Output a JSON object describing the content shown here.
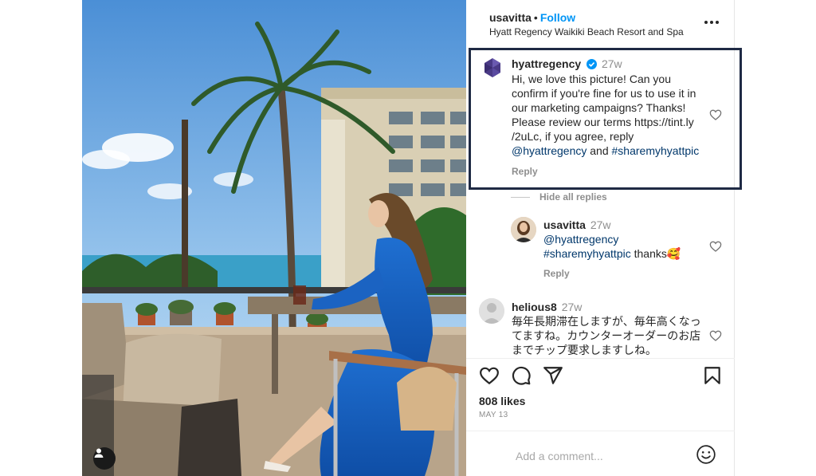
{
  "post": {
    "author": "usavitta",
    "separator": "•",
    "follow_label": "Follow",
    "location": "Hyatt Regency Waikiki Beach Resort and Spa"
  },
  "comments": [
    {
      "user": "hyattregency",
      "verified": true,
      "time": "27w",
      "lines": [
        "Hi, we love this picture! Can you",
        "confirm if you're fine for us to use it in",
        "our marketing campaigns? Thanks!",
        "Please review our terms https://tint.ly",
        "/2uLc, if you agree, reply"
      ],
      "mention": "@hyattregency",
      "conjunction": " and ",
      "hashtag": "#sharemyhyattpic",
      "reply_label": "Reply"
    },
    {
      "user": "usavitta",
      "time": "27w",
      "mention": "@hyattregency",
      "hashtag": "#sharemyhyattpic",
      "suffix": " thanks",
      "emoji": "🥰",
      "reply_label": "Reply"
    },
    {
      "user": "helious8",
      "time": "27w",
      "lines": [
        "毎年長期滞在しますが、毎年高くなっ",
        "てますね。カウンターオーダーのお店",
        "までチップ要求しますしね。"
      ]
    }
  ],
  "hide_replies_label": "Hide all replies",
  "likes": "808 likes",
  "date": "MAY 13",
  "add_comment_placeholder": "Add a comment...",
  "colors": {
    "link": "#00376b",
    "follow": "#0095f6",
    "verified": "#0095f6",
    "highlight_border": "#1f2a44",
    "muted": "#8e8e8e"
  },
  "icons": [
    "verified-badge-icon",
    "heart-icon",
    "comment-icon",
    "share-icon",
    "bookmark-icon",
    "emoji-icon",
    "more-icon",
    "user-tag-icon",
    "hyatt-logo"
  ]
}
